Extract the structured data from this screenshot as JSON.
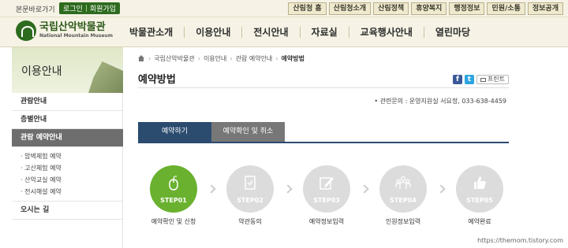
{
  "topbar": {
    "skip_link": "본문바로가기",
    "login": "로그인",
    "join": "회원가입",
    "links": [
      "산림청 홈",
      "산림청소개",
      "산림정책",
      "휴양복지",
      "행정정보",
      "민원/소통",
      "정보공개"
    ]
  },
  "logo": {
    "korean": "국립산악박물관",
    "english": "National Mountain Museum"
  },
  "gnb": [
    "박물관소개",
    "이용안내",
    "전시안내",
    "자료실",
    "교육행사안내",
    "열린마당"
  ],
  "sidebar": {
    "title": "이용안내",
    "items": [
      "관람안내",
      "층별안내",
      "관람 예약안내"
    ],
    "sub_items": [
      "암벽체험 예약",
      "고산체험 예약",
      "산악교실 예약",
      "전시해설 예약"
    ],
    "last_item": "오시는 길"
  },
  "breadcrumb": [
    "국립산악박물관",
    "이용안내",
    "관람 예약안내",
    "예약방법"
  ],
  "page": {
    "title": "예약방법",
    "print_label": "프린트",
    "contact": "관련문의 : 운영지원실 서요정, 033-638-4459"
  },
  "tabs": [
    "예약하기",
    "예약확인 및 취소"
  ],
  "steps": [
    {
      "label": "STEP01",
      "caption": "예약확인 및 신청",
      "icon": "mouse-icon"
    },
    {
      "label": "STEP02",
      "caption": "약관동의",
      "icon": "document-check-icon"
    },
    {
      "label": "STEP03",
      "caption": "예약정보입력",
      "icon": "edit-icon"
    },
    {
      "label": "STEP04",
      "caption": "인원정보입력",
      "icon": "people-icon"
    },
    {
      "label": "STEP05",
      "caption": "예약완료",
      "icon": "thumbs-up-icon"
    }
  ],
  "colors": {
    "accent_green": "#6ab12f",
    "tab_blue": "#2b4b6f",
    "brand_green": "#2d6b1f"
  },
  "watermark": "https://themom.tistory.com"
}
